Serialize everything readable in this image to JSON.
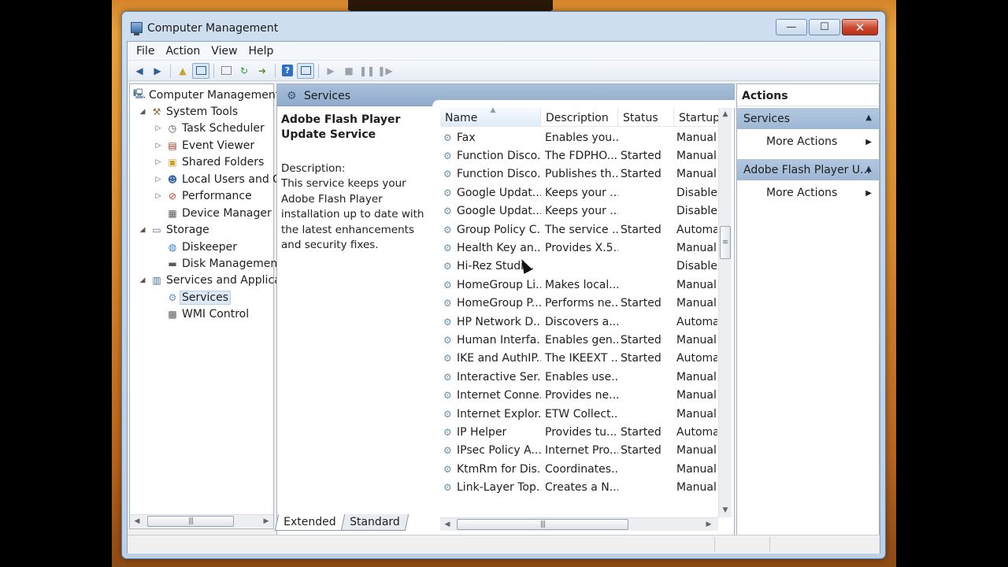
{
  "window": {
    "title": "Computer Management"
  },
  "menubar": [
    "File",
    "Action",
    "View",
    "Help"
  ],
  "tree": {
    "items": [
      {
        "label": "Computer Management",
        "icon": "computer-management-icon",
        "level": 0,
        "arrow": ""
      },
      {
        "label": "System Tools",
        "icon": "system-tools-icon",
        "level": 1,
        "arrow": "expanded"
      },
      {
        "label": "Task Scheduler",
        "icon": "clock-icon",
        "level": 2,
        "arrow": "collapsed"
      },
      {
        "label": "Event Viewer",
        "icon": "event-viewer-icon",
        "level": 2,
        "arrow": "collapsed"
      },
      {
        "label": "Shared Folders",
        "icon": "shared-folder-icon",
        "level": 2,
        "arrow": "collapsed"
      },
      {
        "label": "Local Users and Gr",
        "icon": "users-icon",
        "level": 2,
        "arrow": "collapsed"
      },
      {
        "label": "Performance",
        "icon": "performance-icon",
        "level": 2,
        "arrow": "collapsed"
      },
      {
        "label": "Device Manager",
        "icon": "device-manager-icon",
        "level": 2,
        "arrow": ""
      },
      {
        "label": "Storage",
        "icon": "storage-icon",
        "level": 1,
        "arrow": "expanded"
      },
      {
        "label": "Diskeeper",
        "icon": "diskeeper-icon",
        "level": 2,
        "arrow": ""
      },
      {
        "label": "Disk Management",
        "icon": "disk-management-icon",
        "level": 2,
        "arrow": ""
      },
      {
        "label": "Services and Applicat",
        "icon": "services-applications-icon",
        "level": 1,
        "arrow": "expanded"
      },
      {
        "label": "Services",
        "icon": "gear-icon",
        "level": 2,
        "arrow": "",
        "selected": true
      },
      {
        "label": "WMI Control",
        "icon": "wmi-icon",
        "level": 2,
        "arrow": ""
      }
    ]
  },
  "center": {
    "header": "Services",
    "selected_service": "Adobe Flash Player Update Service",
    "description_label": "Description:",
    "description_text": "This service keeps your Adobe Flash Player installation up to date with the latest enhancements and security fixes.",
    "columns": [
      "Name",
      "Description",
      "Status",
      "Startup"
    ],
    "rows": [
      {
        "name": "Fax",
        "desc": "Enables you...",
        "status": "",
        "startup": "Manual"
      },
      {
        "name": "Function Disco...",
        "desc": "The FDPHO...",
        "status": "Started",
        "startup": "Manual"
      },
      {
        "name": "Function Disco...",
        "desc": "Publishes th...",
        "status": "Started",
        "startup": "Manual"
      },
      {
        "name": "Google Updat...",
        "desc": "Keeps your ...",
        "status": "",
        "startup": "Disable"
      },
      {
        "name": "Google Updat...",
        "desc": "Keeps your ...",
        "status": "",
        "startup": "Disable"
      },
      {
        "name": "Group Policy C...",
        "desc": "The service ...",
        "status": "Started",
        "startup": "Automa"
      },
      {
        "name": "Health Key an...",
        "desc": "Provides X.5...",
        "status": "",
        "startup": "Manual"
      },
      {
        "name": "Hi-Rez Studi...",
        "desc": "",
        "status": "",
        "startup": "Disable"
      },
      {
        "name": "HomeGroup Li...",
        "desc": "Makes local...",
        "status": "",
        "startup": "Manual"
      },
      {
        "name": "HomeGroup P...",
        "desc": "Performs ne...",
        "status": "Started",
        "startup": "Manual"
      },
      {
        "name": "HP Network D...",
        "desc": "Discovers a...",
        "status": "",
        "startup": "Automa"
      },
      {
        "name": "Human Interfa...",
        "desc": "Enables gen...",
        "status": "Started",
        "startup": "Manual"
      },
      {
        "name": "IKE and AuthIP...",
        "desc": "The IKEEXT ...",
        "status": "Started",
        "startup": "Automa"
      },
      {
        "name": "Interactive Ser...",
        "desc": "Enables use...",
        "status": "",
        "startup": "Manual"
      },
      {
        "name": "Internet Conne...",
        "desc": "Provides ne...",
        "status": "",
        "startup": "Manual"
      },
      {
        "name": "Internet Explor...",
        "desc": "ETW Collect...",
        "status": "",
        "startup": "Manual"
      },
      {
        "name": "IP Helper",
        "desc": "Provides tu...",
        "status": "Started",
        "startup": "Automa"
      },
      {
        "name": "IPsec Policy A...",
        "desc": "Internet Pro...",
        "status": "Started",
        "startup": "Manual"
      },
      {
        "name": "KtmRm for Dis...",
        "desc": "Coordinates...",
        "status": "",
        "startup": "Manual"
      },
      {
        "name": "Link-Layer Top...",
        "desc": "Creates a N...",
        "status": "",
        "startup": "Manual"
      }
    ],
    "tabs": [
      "Extended",
      "Standard"
    ],
    "active_tab": "Extended"
  },
  "actions": {
    "title": "Actions",
    "sections": [
      {
        "label": "Services",
        "item": "More Actions"
      },
      {
        "label": "Adobe Flash Player U...",
        "item": "More Actions"
      }
    ]
  },
  "colors": {
    "accent": "#9eb7d4",
    "selection": "#dbe8f5"
  }
}
